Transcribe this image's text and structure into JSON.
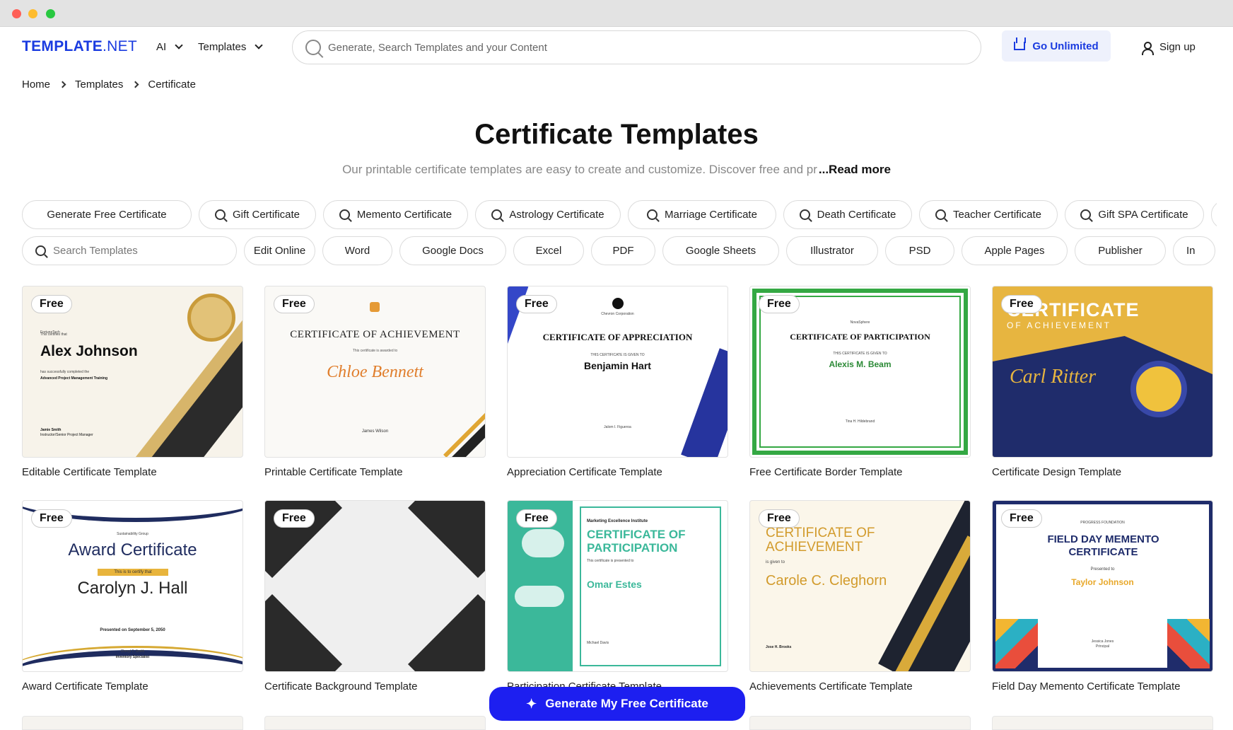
{
  "window": {
    "title": ""
  },
  "header": {
    "logo_bold": "TEMPLATE",
    "logo_light": ".NET",
    "nav_ai": "AI",
    "nav_templates": "Templates",
    "search_placeholder": "Generate, Search Templates and your Content",
    "go_unlimited": "Go Unlimited",
    "sign_up": "Sign up"
  },
  "breadcrumb": [
    "Home",
    "Templates",
    "Certificate"
  ],
  "page": {
    "title": "Certificate Templates",
    "description": "Our printable certificate templates are easy to create and customize. Discover free and pr",
    "read_more": "...Read more"
  },
  "categories": [
    "Generate Free Certificate",
    "Gift Certificate",
    "Memento Certificate",
    "Astrology Certificate",
    "Marriage Certificate",
    "Death Certificate",
    "Teacher Certificate",
    "Gift SPA Certificate"
  ],
  "filters": {
    "search_placeholder": "Search Templates",
    "formats": [
      "Edit Online",
      "Word",
      "Google Docs",
      "Excel",
      "PDF",
      "Google Sheets",
      "Illustrator",
      "PSD",
      "Apple Pages",
      "Publisher",
      "In"
    ]
  },
  "badge_label": "Free",
  "templates": [
    {
      "title": "Editable Certificate Template",
      "preview": {
        "company": "FortuneTech",
        "line": "This certifies that",
        "name": "Alex Johnson",
        "body": "has successfully completed the",
        "course": "Advanced Project Management Training",
        "signer": "Jamie Smith",
        "signer_role": "Instructor/Senior Project Manager"
      }
    },
    {
      "title": "Printable Certificate Template",
      "preview": {
        "heading": "CERTIFICATE OF ACHIEVEMENT",
        "sub": "This certificate is awarded to",
        "name": "Chloe Bennett",
        "signer": "James Wilson"
      }
    },
    {
      "title": "Appreciation Certificate Template",
      "preview": {
        "org": "Chevron Corporation",
        "heading": "CERTIFICATE OF APPRECIATION",
        "sub": "THIS CERTIFICATE IS GIVEN TO",
        "name": "Benjamin Hart",
        "signer": "Jalom I. Figueroa"
      }
    },
    {
      "title": "Free Certificate Border Template",
      "preview": {
        "org": "NovaSphere",
        "heading": "CERTIFICATE OF PARTICIPATION",
        "sub": "THIS CERTIFICATE IS GIVEN TO",
        "name": "Alexis M. Beam",
        "signer": "Tina H. Hildebrand"
      }
    },
    {
      "title": "Certificate Design Template",
      "preview": {
        "heading": "CERTIFICATE",
        "sub": "OF ACHIEVEMENT",
        "name": "Carl Ritter"
      }
    },
    {
      "title": "Award Certificate Template",
      "preview": {
        "org": "Sustainability Group",
        "heading": "Award Certificate",
        "ribbon": "This is to certify that",
        "name": "Carolyn J. Hall",
        "date": "Presented on September 5, 2050",
        "signer": "Cheryl T. Smith",
        "signer_role": "Inventory Specialist"
      }
    },
    {
      "title": "Certificate Background Template",
      "preview": {}
    },
    {
      "title": "Participation Certificate Template",
      "preview": {
        "org": "Marketing Excellence Institute",
        "heading": "CERTIFICATE OF PARTICIPATION",
        "sub": "This certificate is presented to",
        "name": "Omar Estes",
        "signer": "Michael Davis"
      }
    },
    {
      "title": "Achievements Certificate Template",
      "preview": {
        "heading": "CERTIFICATE OF ACHIEVEMENT",
        "sub": "is given to",
        "name": "Carole C. Cleghorn",
        "signer": "Jose H. Brooks"
      }
    },
    {
      "title": "Field Day Memento Certificate Template",
      "preview": {
        "org": "PROGRESS FOUNDATION",
        "heading": "FIELD DAY MEMENTO CERTIFICATE",
        "sub": "Presented to",
        "name": "Taylor Johnson",
        "signer": "Jessica Jones",
        "signer_role": "Principal"
      }
    }
  ],
  "cta": {
    "label": "Generate My Free Certificate"
  },
  "colors": {
    "brand": "#1a3be0",
    "cta": "#1d1ff0",
    "gold": "#d6a933",
    "navy": "#1f2c6b"
  }
}
